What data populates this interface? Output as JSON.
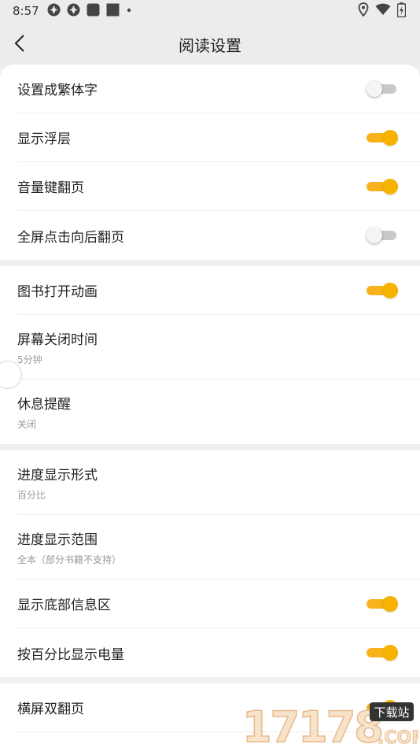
{
  "status": {
    "time": "8:57"
  },
  "header": {
    "title": "阅读设置"
  },
  "sections": [
    {
      "rows": [
        {
          "label": "设置成繁体字",
          "toggle": false
        },
        {
          "label": "显示浮层",
          "toggle": true
        },
        {
          "label": "音量键翻页",
          "toggle": true
        },
        {
          "label": "全屏点击向后翻页",
          "toggle": false
        }
      ]
    },
    {
      "rows": [
        {
          "label": "图书打开动画",
          "toggle": true
        },
        {
          "label": "屏幕关闭时间",
          "sub": "5分钟"
        },
        {
          "label": "休息提醒",
          "sub": "关闭"
        }
      ]
    },
    {
      "rows": [
        {
          "label": "进度显示形式",
          "sub": "百分比"
        },
        {
          "label": "进度显示范围",
          "sub": "全本（部分书籍不支持）"
        },
        {
          "label": "显示底部信息区",
          "toggle": true
        },
        {
          "label": "按百分比显示电量",
          "toggle": true
        }
      ]
    },
    {
      "rows": [
        {
          "label": "横屏双翻页",
          "toggle": true
        }
      ]
    }
  ],
  "watermark": {
    "text": "17178.COM",
    "badge": "下载站"
  },
  "colors": {
    "accent": "#f7b21c",
    "toggle_off": "#c9c9c9",
    "background": "#f0f0f0"
  }
}
